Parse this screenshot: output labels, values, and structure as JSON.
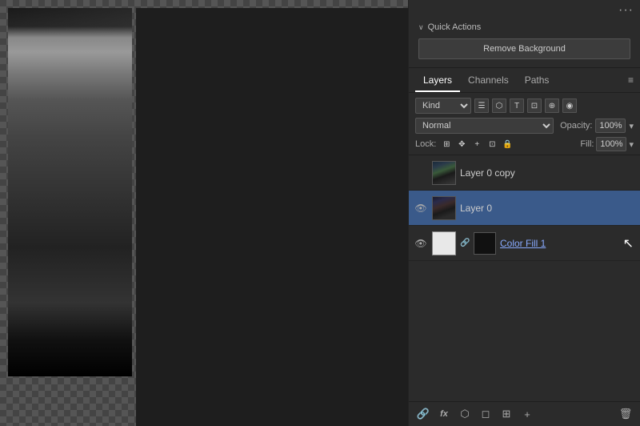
{
  "panel": {
    "three_dots": "···",
    "quick_actions": {
      "collapse_arrow": "∨",
      "title": "Quick Actions",
      "remove_bg_label": "Remove Background"
    },
    "tabs": [
      {
        "label": "Layers",
        "active": true
      },
      {
        "label": "Channels",
        "active": false
      },
      {
        "label": "Paths",
        "active": false
      }
    ],
    "tab_menu": "≡",
    "filter": {
      "kind_label": "Kind",
      "icons": [
        "☰",
        "⬡",
        "T",
        "⊡",
        "⊕"
      ]
    },
    "blend": {
      "mode": "Normal",
      "opacity_label": "Opacity:",
      "opacity_value": "100%"
    },
    "lock": {
      "label": "Lock:",
      "icons": [
        "⊞",
        "✥",
        "+",
        "⊡",
        "🔒"
      ],
      "fill_label": "Fill:",
      "fill_value": "100%"
    },
    "layers": [
      {
        "name": "Layer 0 copy",
        "visible": false,
        "selected": false,
        "has_visibility": false,
        "type": "photo"
      },
      {
        "name": "Layer 0",
        "visible": true,
        "selected": true,
        "type": "photo"
      },
      {
        "name": "Color Fill 1",
        "visible": true,
        "selected": false,
        "type": "color-fill",
        "linked": true
      }
    ],
    "toolbar": {
      "icons": [
        "🔗",
        "fx",
        "⬡",
        "⊕",
        "⊞",
        "🗑"
      ]
    }
  }
}
